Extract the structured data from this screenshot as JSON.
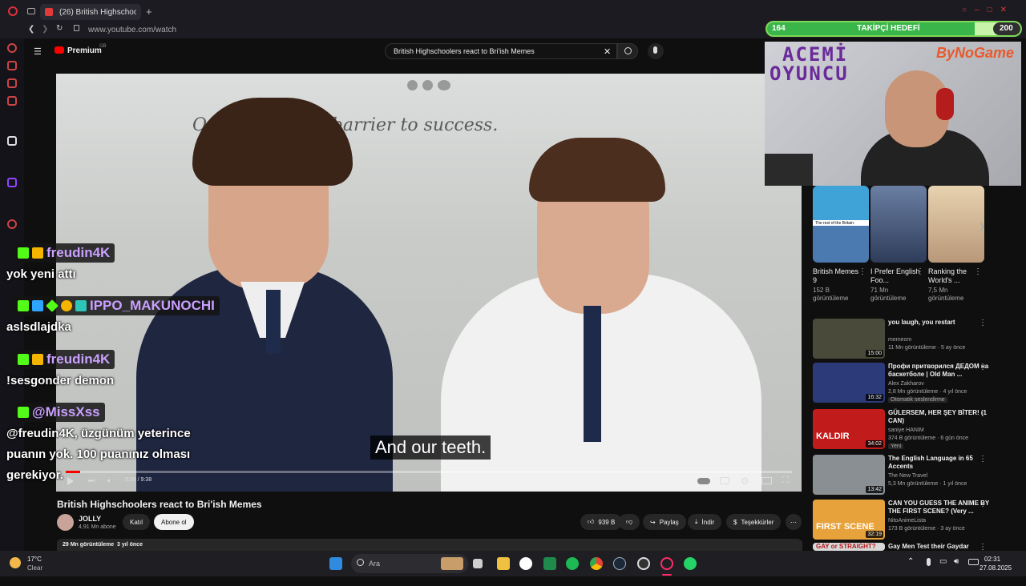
{
  "browser": {
    "tab_title": "(26) British Highschoolers",
    "url": "www.youtube.com/watch"
  },
  "youtube": {
    "logo": "Premium",
    "logo_sup": "GB",
    "search_value": "British Highschoolers react to Bri'ish Memes"
  },
  "video": {
    "wall_quote": "Ori... ever be a barrier to success.",
    "caption": "And our teeth.",
    "time": "0:09 / 9:38",
    "progress_fraction": 0.02,
    "title": "British Highschoolers react to Bri'ish Memes",
    "channel": "JOLLY",
    "subscribers": "4,91 Mn abone",
    "join_label": "Katıl",
    "subscribe_label": "Abone ol",
    "likes": "939 B",
    "share_label": "Paylaş",
    "download_label": "İndir",
    "thanks_label": "Teşekkürler",
    "views_line": "29 Mn görüntüleme  3 yıl önce"
  },
  "chat": [
    {
      "name": "freudin4K",
      "name_color": "#c9a0ff",
      "message": "yok yeni attı"
    },
    {
      "name": "IPPO_MAKUNOCHI",
      "name_color": "#c9a0ff",
      "message": "aslsdlajdka"
    },
    {
      "name": "freudin4K",
      "name_color": "#c9a0ff",
      "message": "!sesgonder demon"
    },
    {
      "name": "@MissXss",
      "name_color": "#c9a0ff",
      "message_1": "@freudin4K, üzgünüm yeterince",
      "message_2": "puanın yok. 100 puanınız olması",
      "message_3": "gerekiyor."
    }
  ],
  "overlay": {
    "goal_current": "164",
    "goal_label": "TAKİPÇİ HEDEFİ",
    "goal_target": "200",
    "goal_fraction": 0.82,
    "cam_text_1": "ACEMİ",
    "cam_text_2": "OYUNCU",
    "brand": "ByNoGame"
  },
  "shorts": [
    {
      "title": "British Memes 9",
      "meta": "152 B görüntüleme",
      "thumb_text": "The rest of the Britain:"
    },
    {
      "title": "I Prefer English Foo...",
      "meta": "71 Mn görüntüleme"
    },
    {
      "title": "Ranking the World's ...",
      "meta": "7,5 Mn görüntüleme"
    }
  ],
  "recommendations": [
    {
      "title": "you laugh, you restart",
      "channel": "memeom",
      "meta": "11 Mn görüntüleme · 5 ay önce",
      "duration": "15:00",
      "color": "#4a4a3a"
    },
    {
      "title": "Профи притворился ДЕДОМ на баскетболе | Old Man ...",
      "channel": "Alex Zakharov",
      "meta": "2,8 Mn görüntüleme · 4 yıl önce",
      "badge": "Otomatik seslendirme",
      "duration": "16:32",
      "color": "#2c3a7a"
    },
    {
      "title": "GÜLERSEM, HER ŞEY BİTER! (1 CAN)",
      "channel": "saniye HANIM",
      "meta": "374 B görüntüleme · 6 gün önce",
      "badge": "Yeni",
      "duration": "34:02",
      "thumb_text": "KALDIR",
      "color": "#c21b1b"
    },
    {
      "title": "The English Language in 65 Accents",
      "channel": "The New Travel",
      "meta": "5,3 Mn görüntüleme · 1 yıl önce",
      "duration": "13:42",
      "color": "#8a8f94"
    },
    {
      "title": "CAN YOU GUESS THE ANIME BY THE FIRST SCENE? (Very ...",
      "channel": "NitoAnimeLista",
      "meta": "173 B görüntüleme · 3 ay önce",
      "duration": "32:19",
      "thumb_text": "FIRST SCENE",
      "color": "#e8a23b"
    },
    {
      "title": "Gay Men Test their Gaydar",
      "thumb_text": "GAY or STRAIGHT?",
      "color": "#d8d8d8"
    }
  ],
  "taskbar": {
    "weather_temp": "17°C",
    "weather_text": "Clear",
    "search_placeholder": "Ara",
    "time": "02:31",
    "date": "27.08.2025"
  }
}
